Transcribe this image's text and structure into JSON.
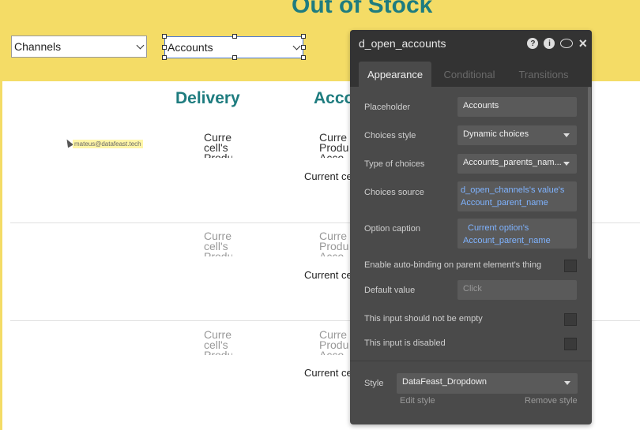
{
  "page": {
    "title": "Out of Stock",
    "channels_dropdown": "Channels",
    "accounts_dropdown": "Accounts",
    "columns": [
      "Delivery",
      "Acco"
    ],
    "user_email": "mateus@datafeast.tech",
    "cell_text_1": "Curre cell's Produ",
    "cell_text_2": "Curre Produ Acco",
    "current_c": "Current ce"
  },
  "panel": {
    "title": "d_open_accounts",
    "tabs": [
      "Appearance",
      "Conditional",
      "Transitions"
    ],
    "fields": {
      "placeholder_label": "Placeholder",
      "placeholder_value": "Accounts",
      "choices_style_label": "Choices style",
      "choices_style_value": "Dynamic choices",
      "type_label": "Type of choices",
      "type_value": "Accounts_parents_nam...",
      "source_label": "Choices source",
      "source_value": "d_open_channels's value's Account_parent_name",
      "caption_label": "Option caption",
      "caption_value": "Current option's Account_parent_name",
      "autobind_label": "Enable auto-binding on parent element's thing",
      "default_label": "Default value",
      "default_placeholder": "Click",
      "not_empty_label": "This input should not be empty",
      "disabled_label": "This input is disabled",
      "style_label": "Style",
      "style_value": "DataFeast_Dropdown",
      "edit_style": "Edit style",
      "remove_style": "Remove style"
    }
  },
  "colors": {
    "background": "#F4DC66",
    "heading": "#1E7C7F",
    "panel": "#4A4A4A",
    "panel_header": "#333333",
    "link": "#7FB3FF"
  }
}
